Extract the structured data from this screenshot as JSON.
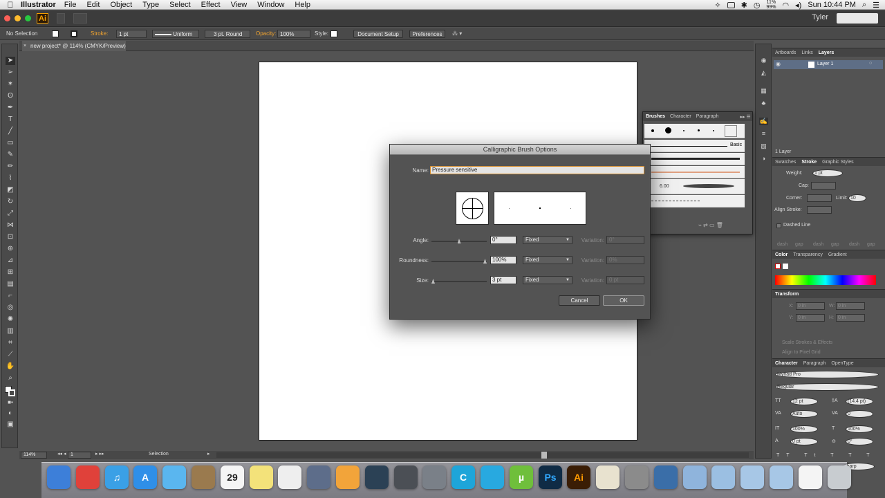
{
  "menubar": {
    "app": "Illustrator",
    "items": [
      "File",
      "Edit",
      "Object",
      "Type",
      "Select",
      "Effect",
      "View",
      "Window",
      "Help"
    ],
    "battery_pct": "11%\n99%",
    "clock": "Sun 10:44 PM"
  },
  "appbar": {
    "logo": "Ai",
    "user": "Tyler"
  },
  "controlbar": {
    "selection": "No Selection",
    "stroke_label": "Stroke:",
    "stroke_value": "1 pt",
    "profile": "Uniform",
    "brush": "3 pt. Round",
    "opacity_label": "Opacity:",
    "opacity_value": "100%",
    "style_label": "Style:",
    "document_setup": "Document Setup",
    "preferences": "Preferences"
  },
  "document": {
    "tab": "new project* @ 114% (CMYK/Preview)"
  },
  "statusbar": {
    "zoom": "114%",
    "artboard": "1",
    "tool": "Selection"
  },
  "layers_panel": {
    "tabs": [
      "Artboards",
      "Links",
      "Layers"
    ],
    "layer_name": "Layer 1",
    "footer": "1 Layer"
  },
  "stroke_panel": {
    "tabs": [
      "Swatches",
      "Stroke",
      "Graphic Styles"
    ],
    "weight_label": "Weight:",
    "weight_value": "1 pt",
    "cap_label": "Cap:",
    "corner_label": "Corner:",
    "limit_label": "Limit:",
    "limit_value": "10",
    "align_label": "Align Stroke:",
    "dashed_label": "Dashed Line",
    "dash_labels": [
      "dash",
      "gap",
      "dash",
      "gap",
      "dash",
      "gap"
    ]
  },
  "color_panel": {
    "tabs": [
      "Color",
      "Transparency",
      "Gradient"
    ]
  },
  "transform_panel": {
    "tab": "Transform",
    "x_label": "X:",
    "y_label": "Y:",
    "w_label": "W:",
    "h_label": "H:",
    "x_value": "0 in",
    "y_value": "0 in",
    "w_value": "0 in",
    "h_value": "0 in",
    "scale_strokes": "Scale Strokes & Effects",
    "align_pixel": "Align to Pixel Grid"
  },
  "character_panel": {
    "tabs": [
      "Character",
      "Paragraph",
      "OpenType"
    ],
    "font": "Myriad Pro",
    "style": "Regular",
    "size": "12 pt",
    "leading": "(14.4 pt)",
    "kerning": "Auto",
    "tracking": "0",
    "v_scale": "100%",
    "h_scale": "100%",
    "baseline": "0 pt",
    "rotation": "0°",
    "aa": "Sharp"
  },
  "brushes_panel": {
    "tabs": [
      "Brushes",
      "Character",
      "Paragraph"
    ],
    "basic_label": "Basic",
    "brush_size": "6.00"
  },
  "dialog": {
    "title": "Calligraphic Brush Options",
    "name_label": "Name:",
    "name_value": "Pressure sensitive",
    "angle_label": "Angle:",
    "angle_value": "0°",
    "angle_mode": "Fixed",
    "angle_slider": 0.5,
    "roundness_label": "Roundness:",
    "roundness_value": "100%",
    "roundness_mode": "Fixed",
    "roundness_slider": 1.0,
    "size_label": "Size:",
    "size_value": "3 pt",
    "size_mode": "Fixed",
    "size_slider": 0.0,
    "variation_label": "Variation:",
    "angle_variation": "0°",
    "roundness_variation": "0%",
    "size_variation": "0 pt",
    "cancel": "Cancel",
    "ok": "OK"
  },
  "dock": {
    "items": [
      {
        "name": "finder",
        "label": "",
        "color": "#3d7fd9"
      },
      {
        "name": "chrome",
        "label": "",
        "color": "#e0413a"
      },
      {
        "name": "itunes",
        "label": "♫",
        "color": "#3aa0e6"
      },
      {
        "name": "app-store",
        "label": "A",
        "color": "#2f8fe8"
      },
      {
        "name": "messages",
        "label": "",
        "color": "#5ab6ef"
      },
      {
        "name": "preview",
        "label": "",
        "color": "#9a7a4e"
      },
      {
        "name": "calendar",
        "label": "29",
        "color": "#f5f5f5"
      },
      {
        "name": "stickies",
        "label": "",
        "color": "#f3e27a"
      },
      {
        "name": "reminders",
        "label": "",
        "color": "#eeeeee"
      },
      {
        "name": "pen-app",
        "label": "",
        "color": "#5d6d8a"
      },
      {
        "name": "toolbox",
        "label": "",
        "color": "#f2a43a"
      },
      {
        "name": "steam",
        "label": "",
        "color": "#2b4155"
      },
      {
        "name": "audio",
        "label": "",
        "color": "#4b4f55"
      },
      {
        "name": "tunes-app",
        "label": "",
        "color": "#7a8088"
      },
      {
        "name": "browser-c",
        "label": "C",
        "color": "#1ea5d9"
      },
      {
        "name": "twitter",
        "label": "",
        "color": "#28a9e0"
      },
      {
        "name": "utorrent",
        "label": "µ",
        "color": "#6fbf3b"
      },
      {
        "name": "photoshop",
        "label": "Ps",
        "color": "#0f2b45"
      },
      {
        "name": "illustrator",
        "label": "Ai",
        "color": "#3a1d05"
      },
      {
        "name": "script-app",
        "label": "",
        "color": "#e8e2cf"
      },
      {
        "name": "system-prefs",
        "label": "",
        "color": "#8b8b8b"
      },
      {
        "name": "quicktime",
        "label": "",
        "color": "#3a6ea8"
      },
      {
        "name": "folder-1",
        "label": "",
        "color": "#8fb4dc"
      },
      {
        "name": "folder-2",
        "label": "",
        "color": "#9bbfe2"
      },
      {
        "name": "folder-3",
        "label": "",
        "color": "#a7c7e6"
      },
      {
        "name": "folder-4",
        "label": "",
        "color": "#a7c7e6"
      },
      {
        "name": "document-stack",
        "label": "",
        "color": "#f4f4f4"
      },
      {
        "name": "trash",
        "label": "",
        "color": "#c8ccd0"
      }
    ]
  },
  "colors": {
    "accent": "#f2a42f",
    "panel": "#535353",
    "canvas": "#535353"
  }
}
